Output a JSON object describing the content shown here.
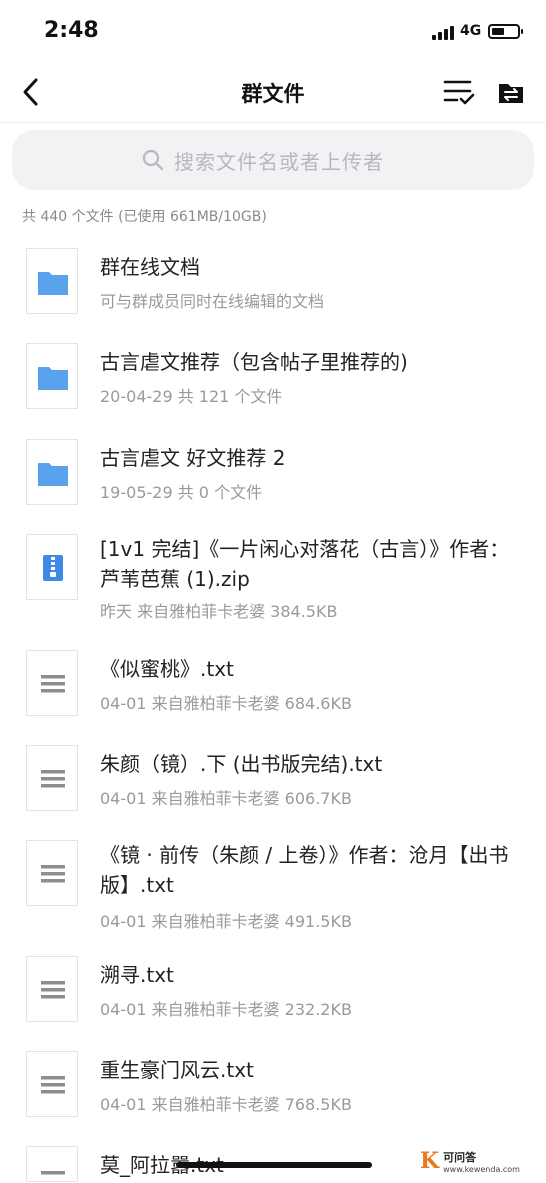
{
  "status": {
    "time": "2:48",
    "network": "4G"
  },
  "nav": {
    "title": "群文件"
  },
  "search": {
    "placeholder": "搜索文件名或者上传者"
  },
  "summary": "共 440 个文件 (已使用 661MB/10GB)",
  "files": [
    {
      "type": "folder",
      "name": "群在线文档",
      "meta": "可与群成员同时在线编辑的文档"
    },
    {
      "type": "folder",
      "name": "古言虐文推荐（包含帖子里推荐的)",
      "meta": "20-04-29 共 121 个文件"
    },
    {
      "type": "folder",
      "name": "古言虐文 好文推荐 2",
      "meta": "19-05-29 共 0 个文件"
    },
    {
      "type": "zip",
      "name": "[1v1 完结]《一片闲心对落花（古言）》作者：芦苇芭蕉 (1).zip",
      "meta": "昨天 来自雅柏菲卡老婆 384.5KB"
    },
    {
      "type": "txt",
      "name": "《似蜜桃》.txt",
      "meta": "04-01 来自雅柏菲卡老婆 684.6KB"
    },
    {
      "type": "txt",
      "name": "朱颜（镜）.下 (出书版完结).txt",
      "meta": "04-01 来自雅柏菲卡老婆 606.7KB"
    },
    {
      "type": "txt",
      "name": "《镜 · 前传（朱颜 / 上卷）》作者：沧月【出书版】.txt",
      "meta": "04-01 来自雅柏菲卡老婆 491.5KB"
    },
    {
      "type": "txt",
      "name": "溯寻.txt",
      "meta": "04-01 来自雅柏菲卡老婆 232.2KB"
    },
    {
      "type": "txt",
      "name": "重生豪门风云.txt",
      "meta": "04-01 来自雅柏菲卡老婆 768.5KB"
    },
    {
      "type": "txt",
      "name": "莫_阿拉嚣.txt",
      "meta": ""
    }
  ],
  "watermark": {
    "name": "可问答",
    "url": "www.kewenda.com"
  },
  "colors": {
    "folder": "#5aa2ec",
    "zip": "#3c8ae6",
    "txt_lines": "#8e8e8e"
  }
}
